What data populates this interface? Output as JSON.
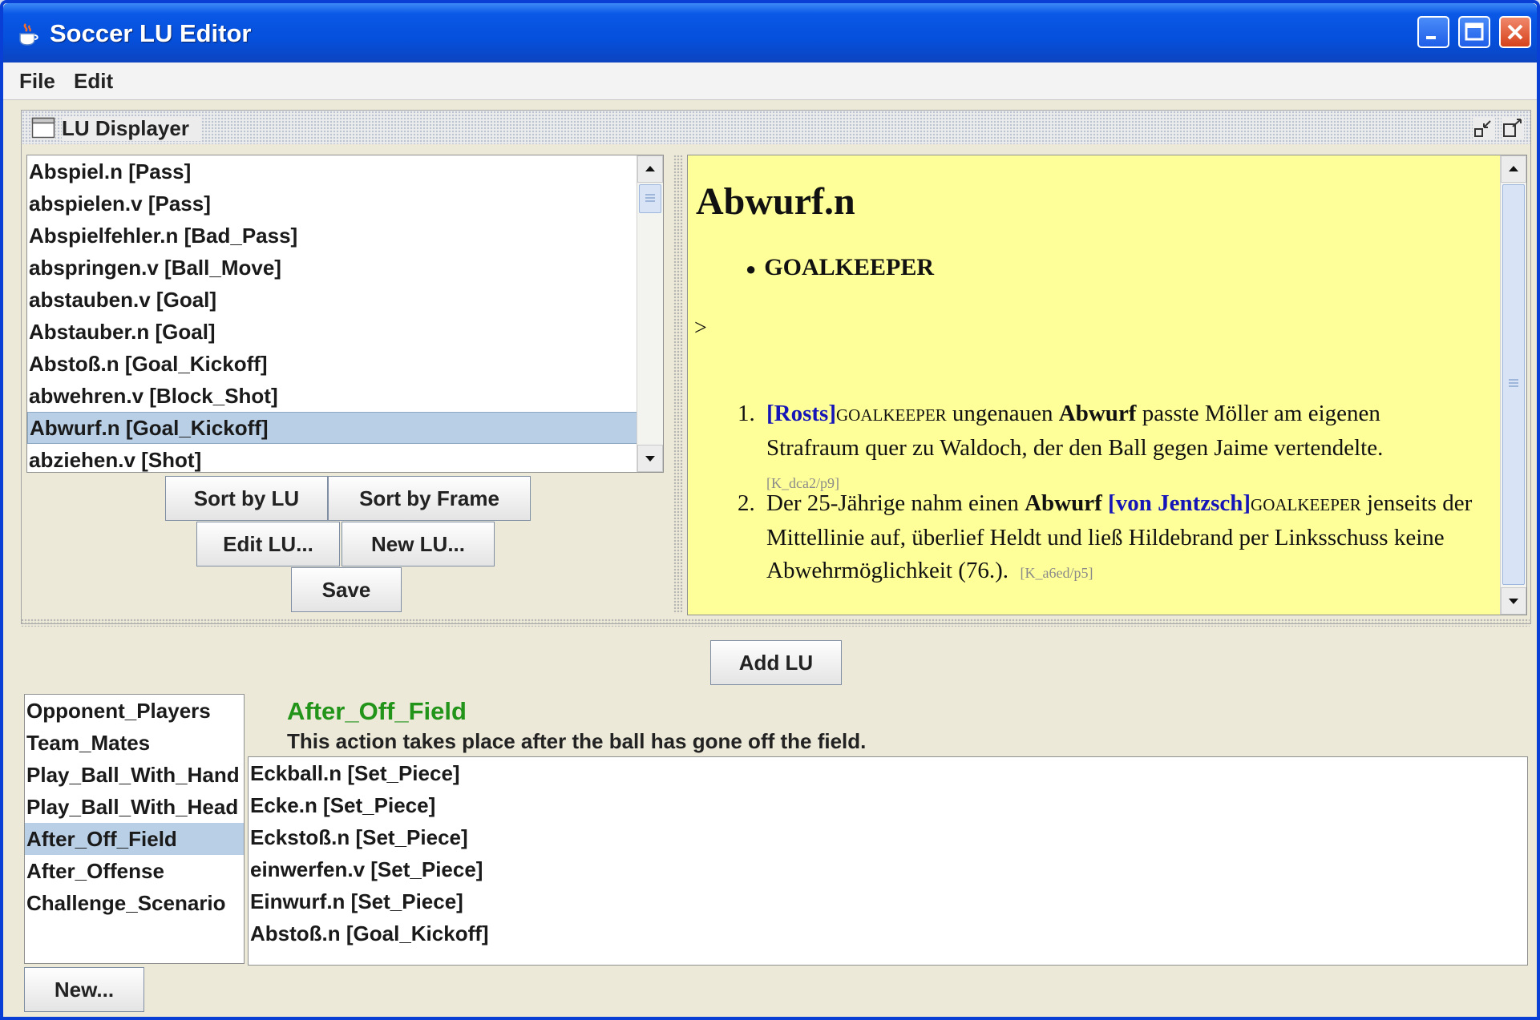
{
  "window": {
    "title": "Soccer LU Editor",
    "controls": [
      "minimize",
      "maximize",
      "close"
    ],
    "accent_color": "#0550dc"
  },
  "menu": [
    "File",
    "Edit"
  ],
  "lu_displayer": {
    "title": "LU Displayer",
    "lu_list": [
      "Abspiel.n [Pass]",
      "abspielen.v [Pass]",
      "Abspielfehler.n [Bad_Pass]",
      "abspringen.v [Ball_Move]",
      "abstauben.v [Goal]",
      "Abstauber.n [Goal]",
      "Abstoß.n [Goal_Kickoff]",
      "abwehren.v [Block_Shot]",
      "Abwurf.n [Goal_Kickoff]",
      "abziehen.v [Shot]"
    ],
    "selected_index": 8,
    "buttons": {
      "sort_lu": "Sort by LU",
      "sort_frame": "Sort by Frame",
      "edit_lu": "Edit LU...",
      "new_lu": "New LU...",
      "save": "Save"
    },
    "definition": {
      "headword": "Abwurf.n",
      "frame_element": "GOALKEEPER",
      "marker": ">",
      "highlight_color": "#ffff99",
      "examples": [
        {
          "num": "1.",
          "fe_text": "[Rosts]",
          "fe_tag": "GOALKEEPER",
          "before_target": " ungenauen ",
          "target": "Abwurf",
          "after_target": " passte Möller am eigenen Strafraum quer zu Waldoch, der den Ball gegen Jaime vertendelte.",
          "source": "[K_dca2/p9]"
        },
        {
          "num": "2.",
          "before_target": "Der 25-Jährige nahm einen ",
          "target": "Abwurf",
          "fe_text": "[von Jentzsch]",
          "fe_tag": "GOALKEEPER",
          "after_target": " jenseits der Mittellinie auf, überlief Heldt und ließ Hildebrand per Linksschuss keine Abwehrmöglichkeit (76.).",
          "source": "[K_a6ed/p5]"
        }
      ]
    }
  },
  "bottom": {
    "add_lu_button": "Add LU",
    "frames": [
      "Opponent_Players",
      "Team_Mates",
      "Play_Ball_With_Hand",
      "Play_Ball_With_Head",
      "After_Off_Field",
      "After_Offense",
      "Challenge_Scenario"
    ],
    "selected_frame_index": 4,
    "frame_name": "After_Off_Field",
    "frame_name_color": "#22941a",
    "frame_definition": "This action takes place after the ball has gone off the field.",
    "frame_lus": [
      "Eckball.n [Set_Piece]",
      "Ecke.n [Set_Piece]",
      "Eckstoß.n [Set_Piece]",
      "einwerfen.v [Set_Piece]",
      "Einwurf.n [Set_Piece]",
      "Abstoß.n [Goal_Kickoff]"
    ],
    "new_button": "New..."
  }
}
